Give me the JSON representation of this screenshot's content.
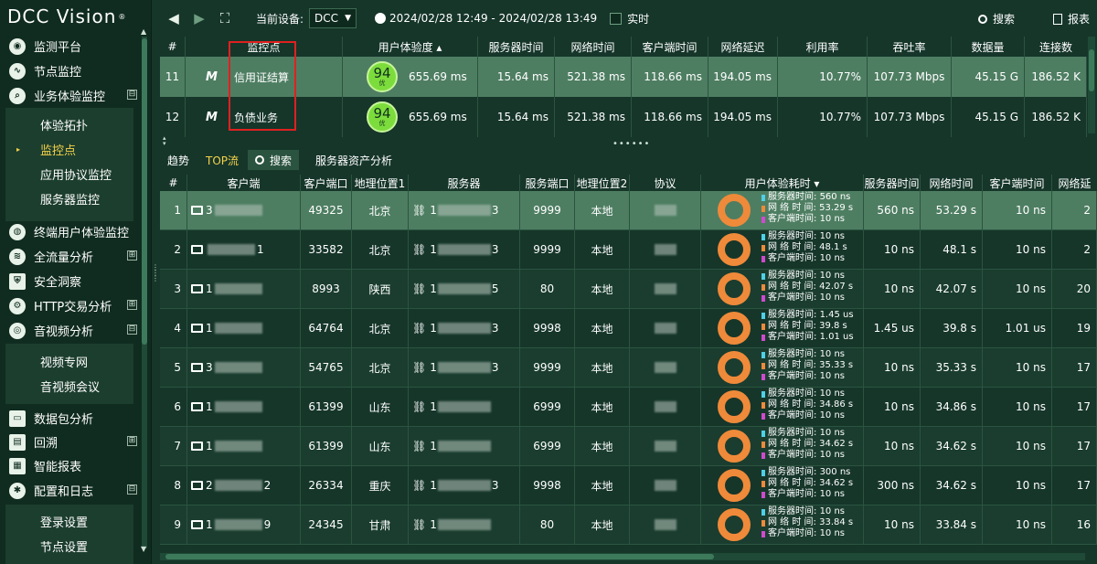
{
  "app": {
    "logo_text": "DCC Vision",
    "logo_mark": "®"
  },
  "sidebar": {
    "items": [
      {
        "label": "监测平台",
        "icon": "dashboard-icon"
      },
      {
        "label": "节点监控",
        "icon": "pulse-icon"
      },
      {
        "label": "业务体验监控",
        "icon": "magnifier-icon",
        "toggle": "⊟"
      },
      {
        "label": "终端用户体验监控",
        "icon": "globe-icon"
      },
      {
        "label": "全流量分析",
        "icon": "waveform-icon",
        "toggle": "⊞"
      },
      {
        "label": "安全洞察",
        "icon": "shield-icon"
      },
      {
        "label": "HTTP交易分析",
        "icon": "gear-icon",
        "toggle": "⊞"
      },
      {
        "label": "音视频分析",
        "icon": "webcam-icon",
        "toggle": "⊟"
      },
      {
        "label": "数据包分析",
        "icon": "monitor-icon"
      },
      {
        "label": "回溯",
        "icon": "printer-icon",
        "toggle": "⊞"
      },
      {
        "label": "智能报表",
        "icon": "report-icon"
      },
      {
        "label": "配置和日志",
        "icon": "settings-icon",
        "toggle": "⊟"
      }
    ],
    "sub_business": [
      "体验拓扑",
      "监控点",
      "应用协议监控",
      "服务器监控"
    ],
    "sub_av": [
      "视频专网",
      "音视频会议"
    ],
    "sub_config": [
      "登录设置",
      "节点设置"
    ]
  },
  "toolbar": {
    "device_label": "当前设备:",
    "device_value": "DCC",
    "time_range": "2024/02/28 12:49 - 2024/02/28 13:49",
    "realtime_label": "实时",
    "search_label": "搜索",
    "report_label": "报表"
  },
  "top_table": {
    "headers": [
      "#",
      "监控点",
      "用户体验度 ▴",
      "服务器时间",
      "网络时间",
      "客户端时间",
      "网络延迟",
      "利用率",
      "吞吐率",
      "数据量",
      "连接数"
    ],
    "rows": [
      {
        "id": "11",
        "name": "信用证结算",
        "score": "94",
        "score_tag": "优",
        "exp": "655.69 ms",
        "server": "15.64 ms",
        "network": "521.38 ms",
        "client": "118.66 ms",
        "latency": "194.05 ms",
        "util": "10.77%",
        "throughput": "107.73 Mbps",
        "volume": "45.15 G",
        "conns": "186.52 K"
      },
      {
        "id": "12",
        "name": "负债业务",
        "score": "94",
        "score_tag": "优",
        "exp": "655.69 ms",
        "server": "15.64 ms",
        "network": "521.38 ms",
        "client": "118.66 ms",
        "latency": "194.05 ms",
        "util": "10.77%",
        "throughput": "107.73 Mbps",
        "volume": "45.15 G",
        "conns": "186.52 K"
      }
    ]
  },
  "tabs": [
    "趋势",
    "TOP流",
    "搜索",
    "服务器资产分析"
  ],
  "bottom_table": {
    "headers": [
      "#",
      "客户端",
      "客户端口",
      "地理位置1",
      "服务器",
      "服务端口",
      "地理位置2",
      "协议",
      "用户体验耗时 ▾",
      "服务器时间",
      "网络时间",
      "客户端时间",
      "网络延"
    ],
    "legend_labels": [
      "服务器时间:",
      "网 络 时 间:",
      "客户端时间:"
    ],
    "legend_colors": [
      "#4fd0e8",
      "#ef8a3a",
      "#d04ad0"
    ],
    "rows": [
      {
        "id": "1",
        "client_prefix": "3",
        "client_suffix": "",
        "cport": "49325",
        "geo1": "北京",
        "server_prefix": "1",
        "server_suffix": "3",
        "sport": "9999",
        "geo2": "本地",
        "s": "560 ns",
        "n": "53.29 s",
        "c": "10 ns",
        "col_s": "560 ns",
        "col_n": "53.29 s",
        "col_c": "10 ns",
        "tail": "2"
      },
      {
        "id": "2",
        "client_prefix": "",
        "client_suffix": "1",
        "cport": "33582",
        "geo1": "北京",
        "server_prefix": "1",
        "server_suffix": "3",
        "sport": "9999",
        "geo2": "本地",
        "s": "10 ns",
        "n": "48.1 s",
        "c": "10 ns",
        "col_s": "10 ns",
        "col_n": "48.1 s",
        "col_c": "10 ns",
        "tail": "2"
      },
      {
        "id": "3",
        "client_prefix": "1",
        "client_suffix": "",
        "cport": "8993",
        "geo1": "陕西",
        "server_prefix": "1",
        "server_suffix": "5",
        "sport": "80",
        "geo2": "本地",
        "s": "10 ns",
        "n": "42.07 s",
        "c": "10 ns",
        "col_s": "10 ns",
        "col_n": "42.07 s",
        "col_c": "10 ns",
        "tail": "20"
      },
      {
        "id": "4",
        "client_prefix": "1",
        "client_suffix": "",
        "cport": "64764",
        "geo1": "北京",
        "server_prefix": "1",
        "server_suffix": "3",
        "sport": "9998",
        "geo2": "本地",
        "s": "1.45 us",
        "n": "39.8 s",
        "c": "1.01 us",
        "col_s": "1.45 us",
        "col_n": "39.8 s",
        "col_c": "1.01 us",
        "tail": "19"
      },
      {
        "id": "5",
        "client_prefix": "3",
        "client_suffix": "",
        "cport": "54765",
        "geo1": "北京",
        "server_prefix": "1",
        "server_suffix": "3",
        "sport": "9999",
        "geo2": "本地",
        "s": "10 ns",
        "n": "35.33 s",
        "c": "10 ns",
        "col_s": "10 ns",
        "col_n": "35.33 s",
        "col_c": "10 ns",
        "tail": "17"
      },
      {
        "id": "6",
        "client_prefix": "1",
        "client_suffix": "",
        "cport": "61399",
        "geo1": "山东",
        "server_prefix": "1",
        "server_suffix": "",
        "sport": "6999",
        "geo2": "本地",
        "s": "10 ns",
        "n": "34.86 s",
        "c": "10 ns",
        "col_s": "10 ns",
        "col_n": "34.86 s",
        "col_c": "10 ns",
        "tail": "17"
      },
      {
        "id": "7",
        "client_prefix": "1",
        "client_suffix": "",
        "cport": "61399",
        "geo1": "山东",
        "server_prefix": "1",
        "server_suffix": "",
        "sport": "6999",
        "geo2": "本地",
        "s": "10 ns",
        "n": "34.62 s",
        "c": "10 ns",
        "col_s": "10 ns",
        "col_n": "34.62 s",
        "col_c": "10 ns",
        "tail": "17"
      },
      {
        "id": "8",
        "client_prefix": "2",
        "client_suffix": "2",
        "cport": "26334",
        "geo1": "重庆",
        "server_prefix": "1",
        "server_suffix": "3",
        "sport": "9998",
        "geo2": "本地",
        "s": "300 ns",
        "n": "34.62 s",
        "c": "10 ns",
        "col_s": "300 ns",
        "col_n": "34.62 s",
        "col_c": "10 ns",
        "tail": "17"
      },
      {
        "id": "9",
        "client_prefix": "1",
        "client_suffix": "9",
        "cport": "24345",
        "geo1": "甘肃",
        "server_prefix": "1",
        "server_suffix": "",
        "sport": "80",
        "geo2": "本地",
        "s": "10 ns",
        "n": "33.84 s",
        "c": "10 ns",
        "col_s": "10 ns",
        "col_n": "33.84 s",
        "col_c": "10 ns",
        "tail": "16"
      }
    ]
  },
  "colors": {
    "bg": "#16362a",
    "sidebar": "#102c20",
    "selected_row": "#4e7e62",
    "active_tab": "#f5d24a",
    "score": "#7cdc3c",
    "donut": "#ef8a3a",
    "highlight_box": "#e02020"
  }
}
